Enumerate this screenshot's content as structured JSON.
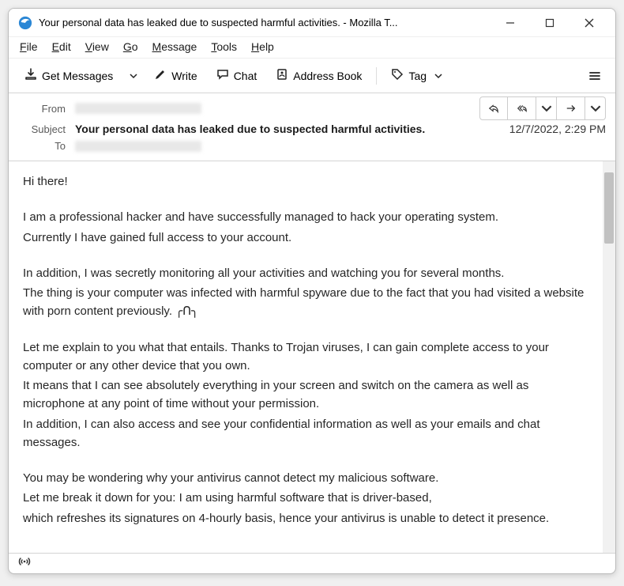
{
  "window": {
    "title": "Your personal data has leaked due to suspected harmful activities. - Mozilla T..."
  },
  "menu": {
    "file": "File",
    "edit": "Edit",
    "view": "View",
    "go": "Go",
    "message": "Message",
    "tools": "Tools",
    "help": "Help"
  },
  "toolbar": {
    "get_messages": "Get Messages",
    "write": "Write",
    "chat": "Chat",
    "address_book": "Address Book",
    "tag": "Tag"
  },
  "headers": {
    "from_label": "From",
    "subject_label": "Subject",
    "to_label": "To",
    "subject": "Your personal data has leaked due to suspected harmful activities.",
    "date": "12/7/2022, 2:29 PM"
  },
  "body": {
    "p1": "Hi there!",
    "p2": "I am a professional hacker and have successfully managed to hack your operating system.",
    "p3": "Currently I have gained full access to your account.",
    "p4": "In addition, I was secretly monitoring all your activities and watching you for several months.",
    "p5": "The thing is your computer was infected with harmful spyware due to the fact that you had visited a website with porn content previously. ╭ᑎ╮",
    "p6": "Let me explain to you what that entails. Thanks to Trojan viruses, I can gain complete access to your computer or any other device that you own.",
    "p7": "It means that I can see absolutely everything in your screen and switch on the camera as well as microphone at any point of time without your permission.",
    "p8": "In addition, I can also access and see your confidential information as well as your emails and chat messages.",
    "p9": "You may be wondering why your antivirus cannot detect my malicious software.",
    "p10": "Let me break it down for you: I am using harmful software that is driver-based,",
    "p11": "which refreshes its signatures on 4-hourly basis, hence your antivirus is unable to detect it presence."
  }
}
